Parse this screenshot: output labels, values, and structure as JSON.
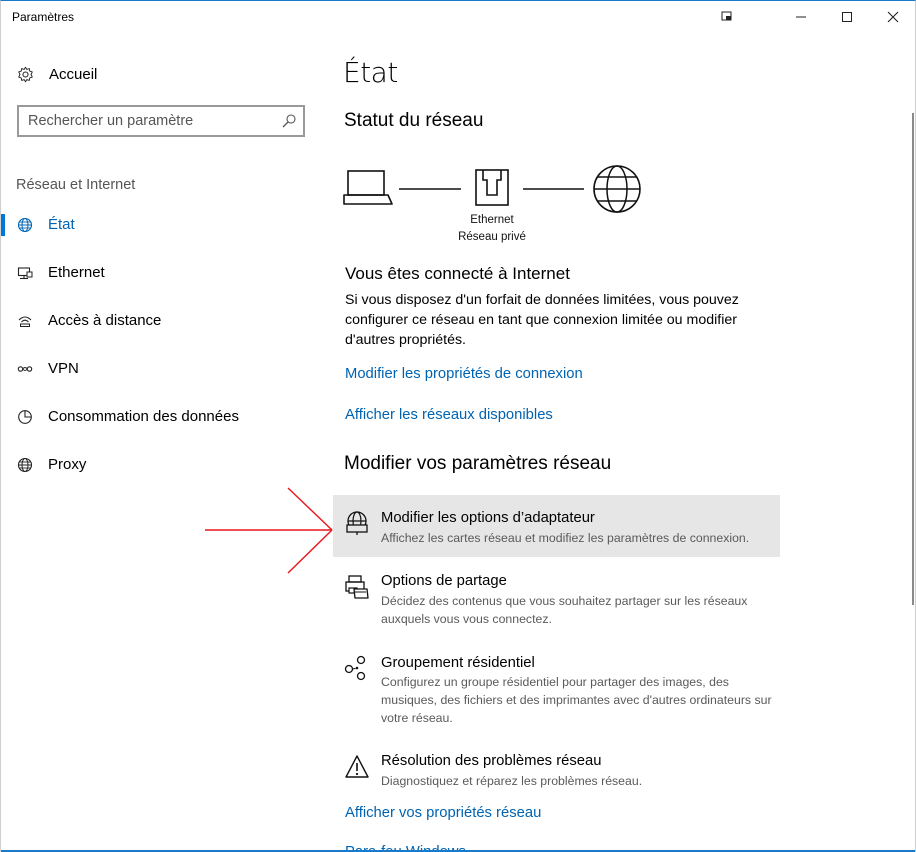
{
  "window": {
    "title": "Paramètres"
  },
  "sidebar": {
    "home_label": "Accueil",
    "search_placeholder": "Rechercher un paramètre",
    "section_title": "Réseau et Internet",
    "items": [
      {
        "label": "État",
        "icon": "globe-icon",
        "active": true
      },
      {
        "label": "Ethernet",
        "icon": "ethernet-icon",
        "active": false
      },
      {
        "label": "Accès à distance",
        "icon": "dialup-icon",
        "active": false
      },
      {
        "label": "VPN",
        "icon": "vpn-icon",
        "active": false
      },
      {
        "label": "Consommation des données",
        "icon": "data-usage-icon",
        "active": false
      },
      {
        "label": "Proxy",
        "icon": "globe-icon",
        "active": false
      }
    ]
  },
  "main": {
    "title": "État",
    "network_status": {
      "heading": "Statut du réseau",
      "connection_name": "Ethernet",
      "network_type": "Réseau privé"
    },
    "connected": {
      "heading": "Vous êtes connecté à Internet",
      "description": "Si vous disposez d'un forfait de données limitées, vous pouvez configurer ce réseau en tant que connexion limitée ou modifier d'autres propriétés."
    },
    "links": {
      "change_properties": "Modifier les propriétés de connexion",
      "show_networks": "Afficher les réseaux disponibles",
      "show_properties": "Afficher vos propriétés réseau",
      "firewall": "Pare-feu Windows"
    },
    "change_settings": {
      "heading": "Modifier vos paramètres réseau",
      "options": [
        {
          "title": "Modifier les options d’adaptateur",
          "description": "Affichez les cartes réseau et modifiez les paramètres de connexion.",
          "icon": "adapter-icon"
        },
        {
          "title": "Options de partage",
          "description": "Décidez des contenus que vous souhaitez partager sur les réseaux auxquels vous vous connectez.",
          "icon": "sharing-icon"
        },
        {
          "title": "Groupement résidentiel",
          "description": "Configurez un groupe résidentiel pour partager des images, des musiques, des fichiers et des imprimantes avec d'autres ordinateurs sur votre réseau.",
          "icon": "homegroup-icon"
        },
        {
          "title": "Résolution des problèmes réseau",
          "description": "Diagnostiquez et réparez les problèmes réseau.",
          "icon": "warning-icon"
        }
      ]
    }
  },
  "colors": {
    "accent": "#0078d7",
    "link": "#0063b1",
    "highlight": "#e6e6e6",
    "annotation_arrow": "#e8141b"
  }
}
